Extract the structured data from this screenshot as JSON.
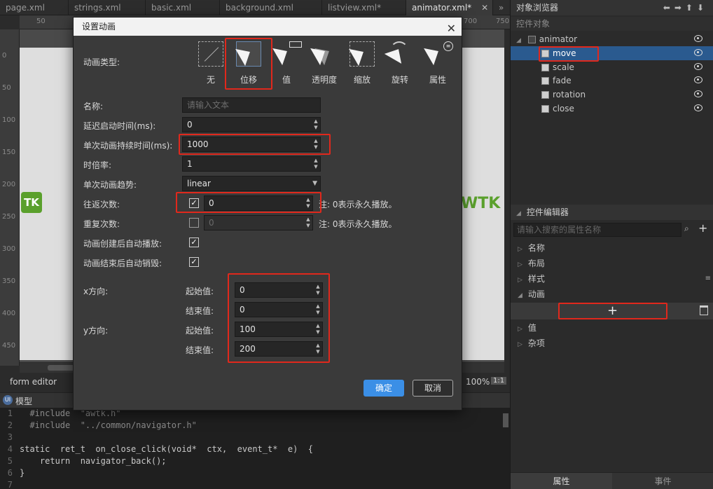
{
  "tabs": [
    {
      "label": "page.xml",
      "active": false
    },
    {
      "label": "strings.xml",
      "active": false
    },
    {
      "label": "basic.xml",
      "active": false
    },
    {
      "label": "background.xml",
      "active": false
    },
    {
      "label": "listview.xml*",
      "active": false
    },
    {
      "label": "animator.xml*",
      "active": true
    }
  ],
  "tab_overflow": "»",
  "ruler": {
    "h": [
      "50",
      "700",
      "750"
    ],
    "v": [
      "0",
      "50",
      "100",
      "150",
      "200",
      "250",
      "300",
      "350",
      "400",
      "450"
    ]
  },
  "canvas": {
    "logo_left": "TK",
    "logo_right": "WTK"
  },
  "form_editor_label": "form  editor",
  "zoom": "100%",
  "zoom_fit": "1:1",
  "code_panel": {
    "tab_label": "模型",
    "lines": [
      {
        "n": "1",
        "text": "  #include  \"awtk.h\""
      },
      {
        "n": "2",
        "text": "  #include  \"../common/navigator.h\""
      },
      {
        "n": "3",
        "text": ""
      },
      {
        "n": "4",
        "text": "static  ret_t  on_close_click(void*  ctx,  event_t*  e)  {"
      },
      {
        "n": "5",
        "text": "    return  navigator_back();"
      },
      {
        "n": "6",
        "text": "}"
      },
      {
        "n": "7",
        "text": ""
      }
    ]
  },
  "object_browser": {
    "title": "对象浏览器",
    "subheader": "控件对象",
    "root": "animator",
    "items": [
      {
        "label": "move",
        "selected": true
      },
      {
        "label": "scale",
        "selected": false
      },
      {
        "label": "fade",
        "selected": false
      },
      {
        "label": "rotation",
        "selected": false
      },
      {
        "label": "close",
        "selected": false
      }
    ]
  },
  "widget_editor": {
    "title": "控件编辑器",
    "search_placeholder": "请输入搜索的属性名称",
    "groups": [
      {
        "label": "名称",
        "expanded": false
      },
      {
        "label": "布局",
        "expanded": false
      },
      {
        "label": "样式",
        "expanded": false
      },
      {
        "label": "动画",
        "expanded": true
      },
      {
        "label": "值",
        "expanded": false
      },
      {
        "label": "杂项",
        "expanded": false
      }
    ],
    "add_symbol": "+",
    "bottom_tabs": [
      "属性",
      "事件"
    ]
  },
  "dialog": {
    "title": "设置动画",
    "anim_type_label": "动画类型:",
    "anim_types": [
      "无",
      "位移",
      "值",
      "透明度",
      "缩放",
      "旋转",
      "属性"
    ],
    "selected_type": "位移",
    "name_label": "名称:",
    "name_placeholder": "请输入文本",
    "delay_label": "延迟启动时间(ms):",
    "delay_value": "0",
    "duration_label": "单次动画持续时间(ms):",
    "duration_value": "1000",
    "time_scale_label": "时倍率:",
    "time_scale_value": "1",
    "easing_label": "单次动画趋势:",
    "easing_value": "linear",
    "yoyo_label": "往返次数:",
    "yoyo_checked": true,
    "yoyo_value": "0",
    "yoyo_note": "注: 0表示永久播放。",
    "repeat_label": "重复次数:",
    "repeat_checked": false,
    "repeat_value": "0",
    "repeat_note": "注: 0表示永久播放。",
    "auto_start_label": "动画创建后自动播放:",
    "auto_start": true,
    "auto_destroy_label": "动画结束后自动销毁:",
    "auto_destroy": true,
    "x_label": "x方向:",
    "y_label": "y方向:",
    "start_label": "起始值:",
    "end_label": "结束值:",
    "x_from": "0",
    "x_to": "0",
    "y_from": "100",
    "y_to": "200",
    "ok_label": "确定",
    "cancel_label": "取消"
  },
  "colors": {
    "accent": "#3b8fe6",
    "highlight": "#e0281c",
    "selection": "#2a5a8f",
    "logo_green": "#5aa02c"
  }
}
